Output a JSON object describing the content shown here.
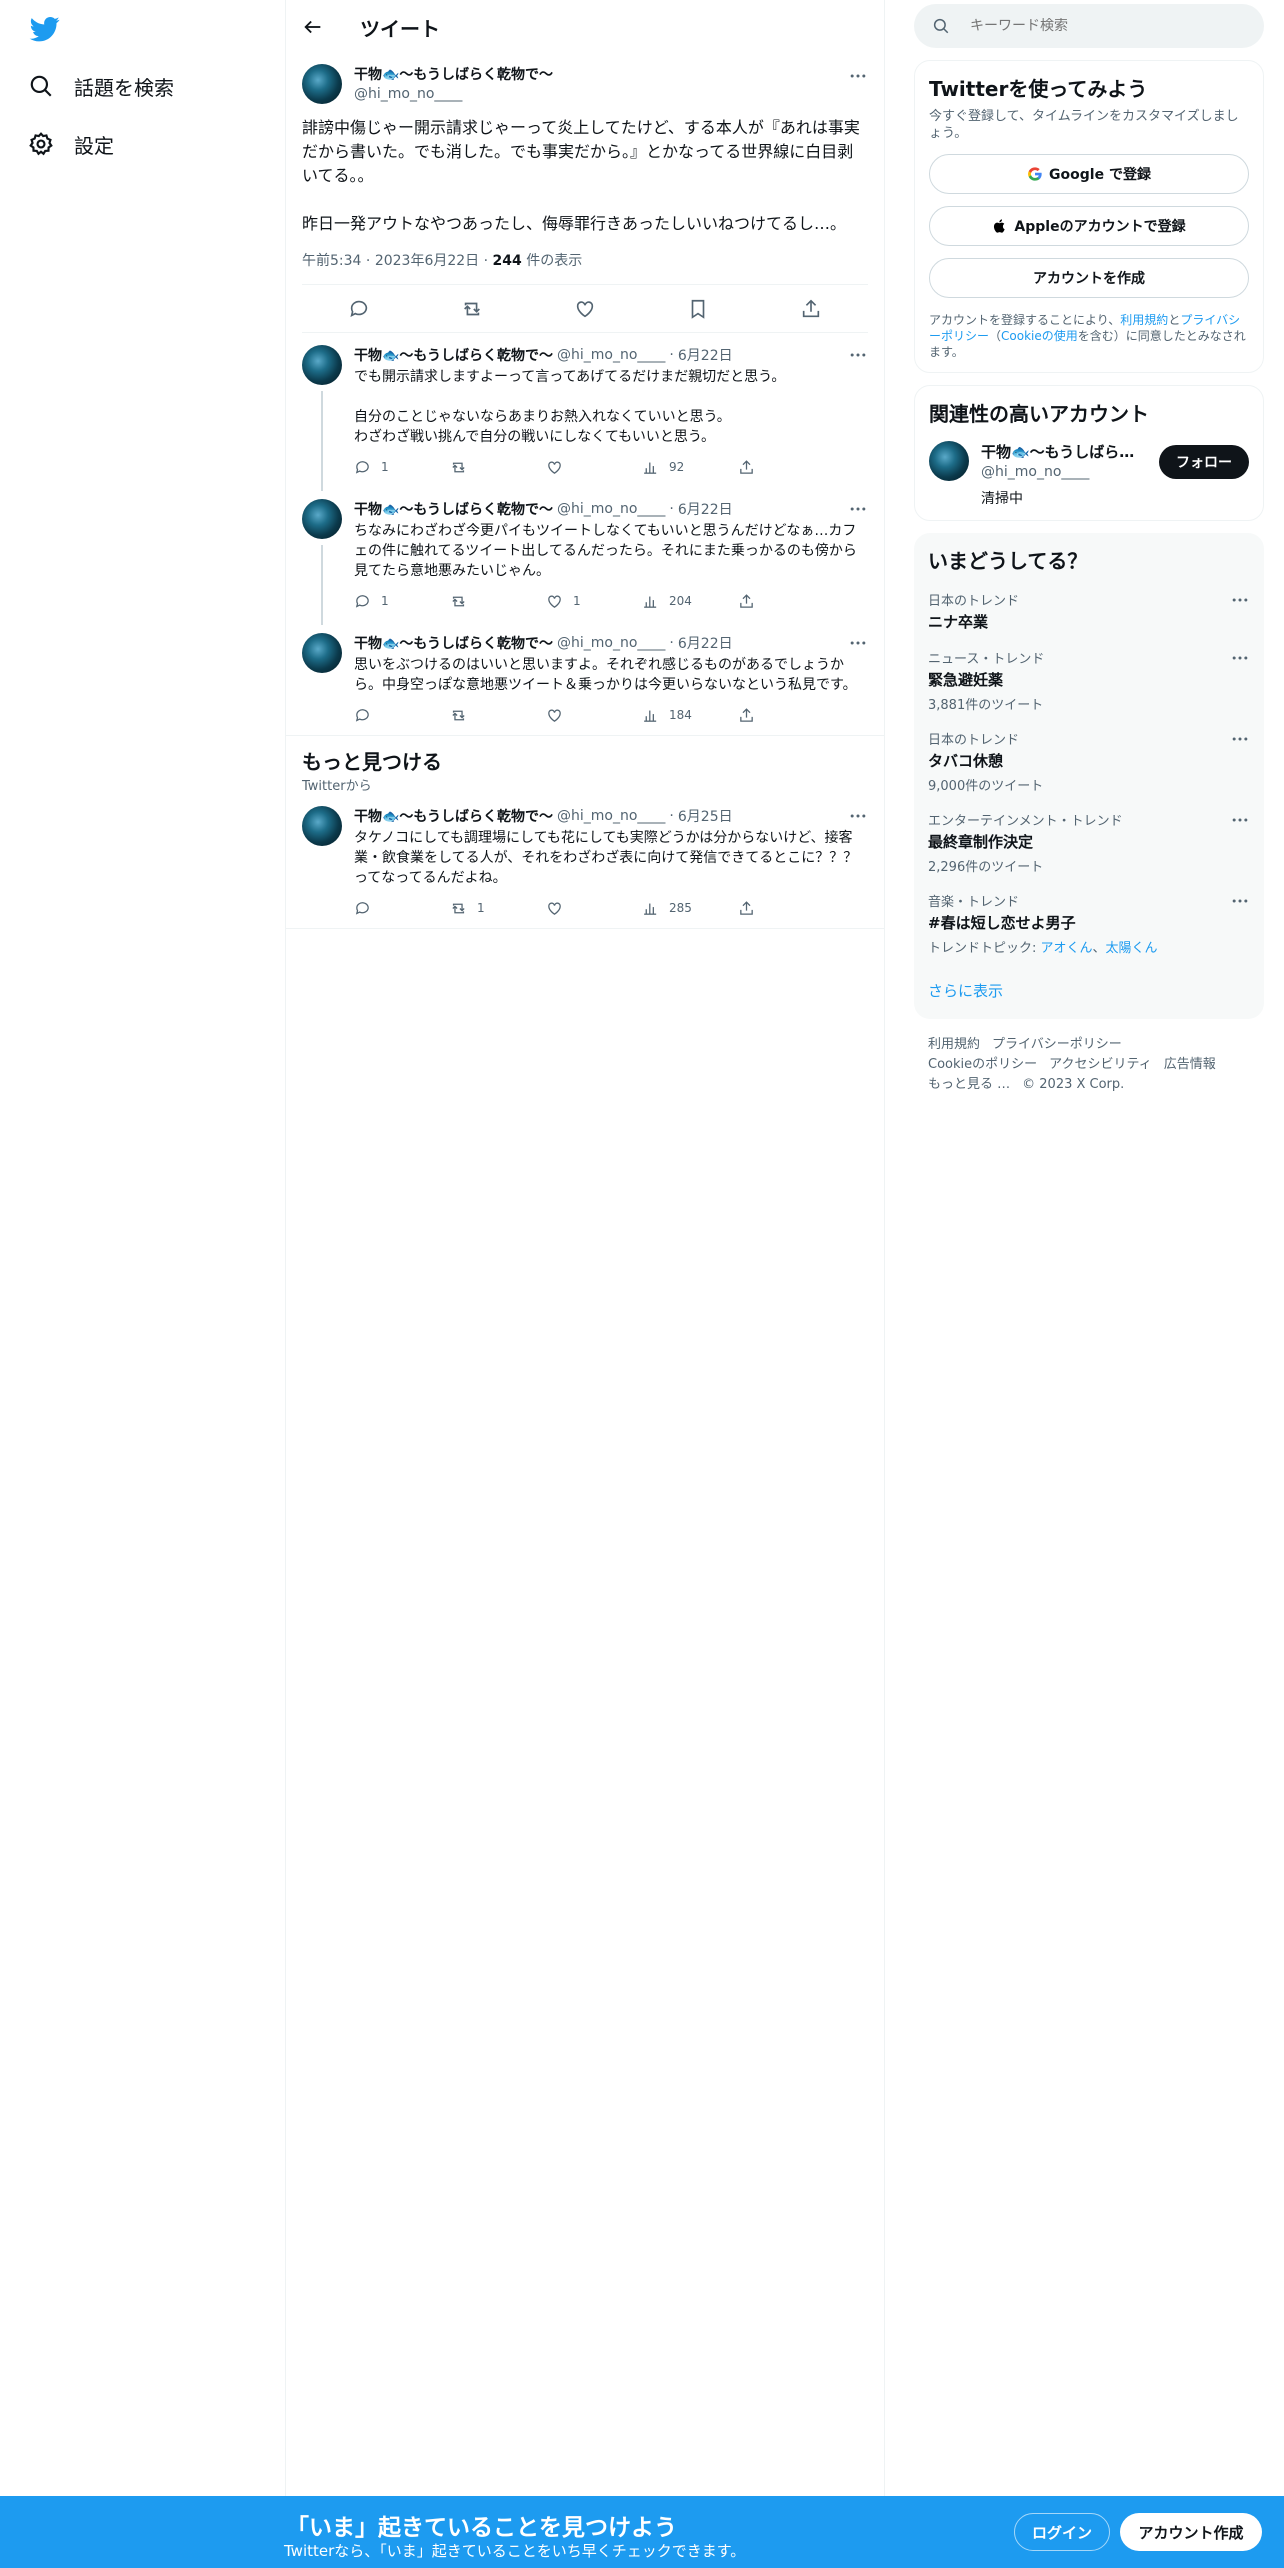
{
  "colors": {
    "accent": "#1d9bf0",
    "text": "#0f1419",
    "muted": "#536471"
  },
  "nav": {
    "logo_icon": "twitter-bird-icon",
    "items": [
      {
        "label": "話題を検索",
        "icon": "search-icon"
      },
      {
        "label": "設定",
        "icon": "gear-icon"
      }
    ]
  },
  "header": {
    "title": "ツイート",
    "back_icon": "back-arrow-icon"
  },
  "main_tweet": {
    "author_name": "干物🐟〜もうしばらく乾物で〜",
    "author_handle": "@hi_mo_no____",
    "text": "誹謗中傷じゃー開示請求じゃーって炎上してたけど、する本人が『あれは事実だから書いた。でも消した。でも事実だから。』とかなってる世界線に白目剥いてる。。\n\n昨日一発アウトなやつあったし、侮辱罪行きあったしいいねつけてるし…。",
    "time": "午前5:34",
    "date": "2023年6月22日",
    "views": "244",
    "views_label": "件の表示"
  },
  "replies": [
    {
      "name": "干物🐟〜もうしばらく乾物で〜",
      "handle": "@hi_mo_no____",
      "date": "6月22日",
      "text": "でも開示請求しますよーって言ってあげてるだけまだ親切だと思う。\n\n自分のことじゃないならあまりお熱入れなくていいと思う。\nわざわざ戦い挑んで自分の戦いにしなくてもいいと思う。",
      "reply_count": "1",
      "retweet_count": "",
      "like_count": "",
      "view_count": "92"
    },
    {
      "name": "干物🐟〜もうしばらく乾物で〜",
      "handle": "@hi_mo_no____",
      "date": "6月22日",
      "text": "ちなみにわざわざ今更パイもツイートしなくてもいいと思うんだけどなぁ…カフェの件に触れてるツイート出してるんだったら。それにまた乗っかるのも傍から見てたら意地悪みたいじゃん。",
      "reply_count": "1",
      "retweet_count": "",
      "like_count": "1",
      "view_count": "204"
    },
    {
      "name": "干物🐟〜もうしばらく乾物で〜",
      "handle": "@hi_mo_no____",
      "date": "6月22日",
      "text": "思いをぶつけるのはいいと思いますよ。それぞれ感じるものがあるでしょうから。中身空っぽな意地悪ツイート＆乗っかりは今更いらないなという私見です。",
      "reply_count": "",
      "retweet_count": "",
      "like_count": "",
      "view_count": "184"
    }
  ],
  "discover": {
    "title": "もっと見つける",
    "subtitle": "Twitterから",
    "tweet": {
      "name": "干物🐟〜もうしばらく乾物で〜",
      "handle": "@hi_mo_no____",
      "date": "6月25日",
      "text": "タケノコにしても調理場にしても花にしても実際どうかは分からないけど、接客業・飲食業をしてる人が、それをわざわざ表に向けて発信できてるとこに？？？ってなってるんだよね。",
      "reply_count": "",
      "retweet_count": "1",
      "like_count": "",
      "view_count": "285"
    }
  },
  "sidebar": {
    "search_placeholder": "キーワード検索",
    "signup": {
      "title": "Twitterを使ってみよう",
      "subtitle": "今すぐ登録して、タイムラインをカスタマイズしましょう。",
      "google_label": "Google で登録",
      "apple_label": "Appleのアカウントで登録",
      "create_label": "アカウントを作成",
      "legal_prefix": "アカウントを登録することにより、",
      "legal_terms": "利用規約",
      "legal_and": "と",
      "legal_privacy": "プライバシーポリシー",
      "legal_open": "（",
      "legal_cookie": "Cookieの使用",
      "legal_suffix": "を含む）に同意したとみなされます。"
    },
    "related": {
      "title": "関連性の高いアカウント",
      "name": "干物🐟〜もうしばら…",
      "handle": "@hi_mo_no____",
      "bio": "清掃中",
      "follow_label": "フォロー"
    },
    "trends": {
      "title": "いまどうしてる？",
      "items": [
        {
          "category": "日本のトレンド",
          "topic": "ニナ卒業",
          "count": ""
        },
        {
          "category": "ニュース・トレンド",
          "topic": "緊急避妊薬",
          "count": "3,881件のツイート"
        },
        {
          "category": "日本のトレンド",
          "topic": "タバコ休憩",
          "count": "9,000件のツイート"
        },
        {
          "category": "エンターテインメント・トレンド",
          "topic": "最終章制作決定",
          "count": "2,296件のツイート"
        },
        {
          "category": "音楽・トレンド",
          "topic": "#春は短し恋せよ男子",
          "count": "",
          "related_prefix": "トレンドトピック: ",
          "related_1": "アオくん",
          "related_sep": "、",
          "related_2": "太陽くん"
        }
      ],
      "show_more": "さらに表示"
    },
    "footer": [
      "利用規約",
      "プライバシーポリシー",
      "Cookieのポリシー",
      "アクセシビリティ",
      "広告情報",
      "もっと見る …",
      "© 2023 X Corp."
    ]
  },
  "bottom_bar": {
    "title": "「いま」起きていることを見つけよう",
    "subtitle": "Twitterなら、「いま」起きていることをいち早くチェックできます。",
    "login_label": "ログイン",
    "signup_label": "アカウント作成"
  }
}
